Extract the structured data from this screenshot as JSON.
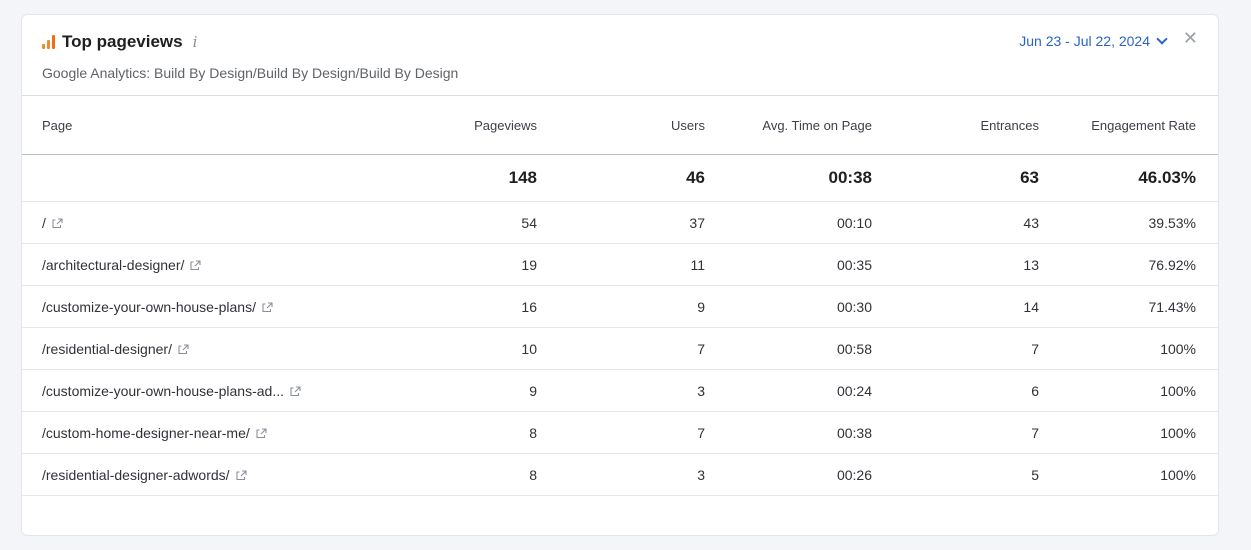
{
  "widget": {
    "title": "Top pageviews",
    "info_icon": "i",
    "subtitle": "Google Analytics: Build By Design/Build By Design/Build By Design",
    "date_range": "Jun 23 - Jul 22, 2024",
    "close_glyph": "✕"
  },
  "columns": {
    "page": "Page",
    "pageviews": "Pageviews",
    "users": "Users",
    "avg_time": "Avg. Time on Page",
    "entrances": "Entrances",
    "engagement": "Engagement Rate"
  },
  "totals": {
    "pageviews": "148",
    "users": "46",
    "avg_time": "00:38",
    "entrances": "63",
    "engagement": "46.03%"
  },
  "rows": [
    {
      "page": "/",
      "pageviews": "54",
      "users": "37",
      "avg_time": "00:10",
      "entrances": "43",
      "engagement": "39.53%"
    },
    {
      "page": "/architectural-designer/",
      "pageviews": "19",
      "users": "11",
      "avg_time": "00:35",
      "entrances": "13",
      "engagement": "76.92%"
    },
    {
      "page": "/customize-your-own-house-plans/",
      "pageviews": "16",
      "users": "9",
      "avg_time": "00:30",
      "entrances": "14",
      "engagement": "71.43%"
    },
    {
      "page": "/residential-designer/",
      "pageviews": "10",
      "users": "7",
      "avg_time": "00:58",
      "entrances": "7",
      "engagement": "100%"
    },
    {
      "page": "/customize-your-own-house-plans-ad...",
      "pageviews": "9",
      "users": "3",
      "avg_time": "00:24",
      "entrances": "6",
      "engagement": "100%"
    },
    {
      "page": "/custom-home-designer-near-me/",
      "pageviews": "8",
      "users": "7",
      "avg_time": "00:38",
      "entrances": "7",
      "engagement": "100%"
    },
    {
      "page": "/residential-designer-adwords/",
      "pageviews": "8",
      "users": "3",
      "avg_time": "00:26",
      "entrances": "5",
      "engagement": "100%"
    }
  ],
  "icons": {
    "title_icon": "bar-chart-icon",
    "external_link": "external-link-icon",
    "close": "close-icon",
    "dropdown": "chevron-down-icon",
    "info": "info-icon"
  },
  "colors": {
    "accent_link": "#2b64c5",
    "title_icon_orange": "#f28b2c"
  }
}
